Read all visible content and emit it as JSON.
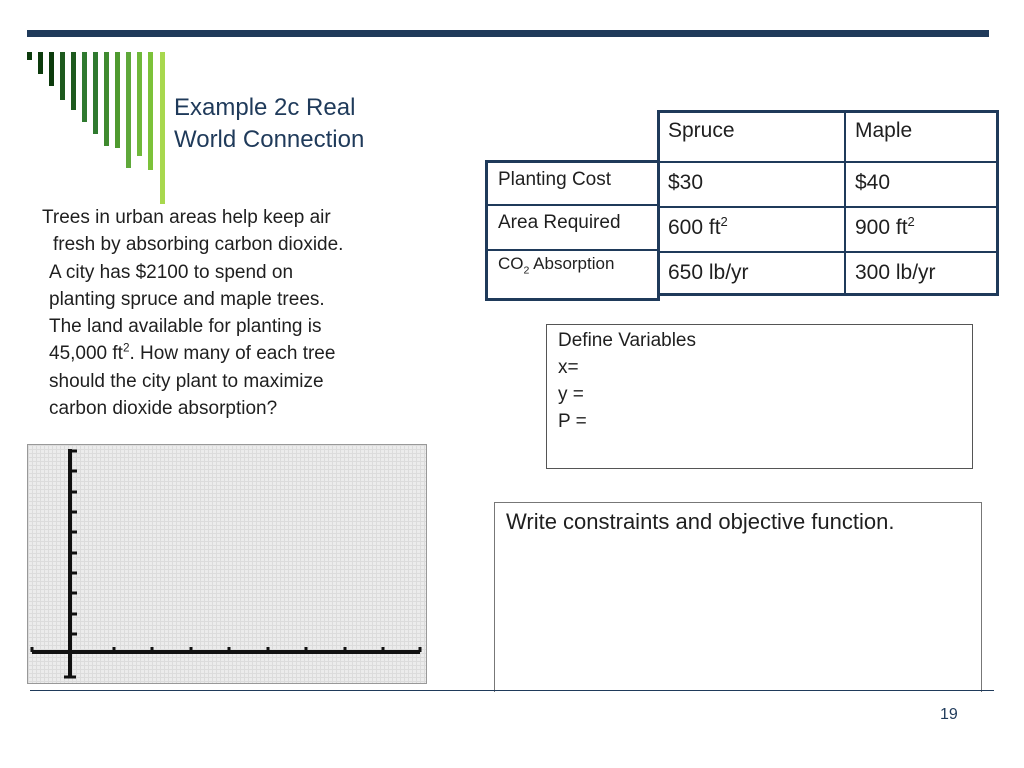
{
  "slide": {
    "title_line1": "Example 2c  Real",
    "title_line2": "World Connection",
    "page_number": "19",
    "accent_color": "#1f3a5a",
    "stripe_colors": [
      "#0d3b0d",
      "#1e5a1e",
      "#2f7a2f",
      "#4f9a2f",
      "#7cc23a",
      "#a8d84e"
    ]
  },
  "problem": {
    "line1": "Trees in urban areas help keep air",
    "line2": "fresh by absorbing carbon dioxide.",
    "line3": "A city has $2100 to spend on",
    "line4": "planting spruce and maple trees.",
    "line5": "The land available for planting is",
    "line6_pre": "45,000 ft",
    "line6_sup": "2",
    "line6_post": ".  How many of each tree",
    "line7": "should the city plant to maximize",
    "line8": "carbon dioxide absorption?"
  },
  "table": {
    "col1": "Spruce",
    "col2": "Maple",
    "rows": [
      {
        "label": "Planting Cost",
        "spruce": "$30",
        "maple": "$40"
      },
      {
        "label": "Area Required",
        "spruce": "600 ft",
        "spruce_sup": "2",
        "maple": "900 ft",
        "maple_sup": "2"
      },
      {
        "label_pre": "CO",
        "label_sub": "2",
        "label_post": " Absorption",
        "spruce": "650 lb/yr",
        "maple": "300 lb/yr"
      }
    ]
  },
  "define": {
    "heading": "Define Variables",
    "x": "x=",
    "y": "y =",
    "p": "P ="
  },
  "constraints": {
    "heading": "Write constraints and objective function."
  }
}
